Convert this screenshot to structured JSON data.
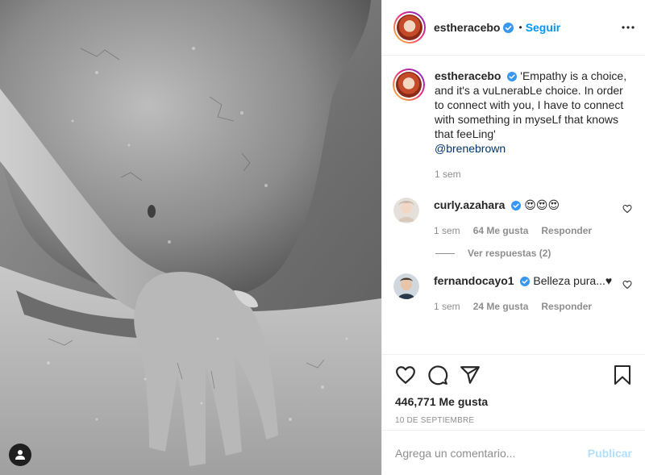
{
  "post": {
    "author": "estheracebo",
    "follow_label": "Seguir",
    "dot": "•",
    "caption_text": "'Empathy is a choice, and it's a vuLnerabLe choice. In order to connect with you, I have to connect with something in myseLf that knows that feeLing'",
    "caption_mention": "@brenebrown",
    "caption_time": "1 sem",
    "likes_label": "446,771 Me gusta",
    "date_label": "10 DE SEPTIEMBRE"
  },
  "comments": [
    {
      "user": "curly.azahara",
      "text": "😍😍😍",
      "time": "1 sem",
      "likes": "64 Me gusta",
      "reply_label": "Responder",
      "view_replies": "Ver respuestas (2)"
    },
    {
      "user": "fernandocayo1",
      "text": "Belleza pura...♥",
      "time": "1 sem",
      "likes": "24 Me gusta",
      "reply_label": "Responder"
    }
  ],
  "composer": {
    "placeholder": "Agrega un comentario...",
    "publish_label": "Publicar"
  },
  "icons": {
    "more": "more-options-icon",
    "verified": "verified-badge-icon",
    "like": "heart-icon",
    "comment": "comment-icon",
    "share": "share-icon",
    "save": "bookmark-icon",
    "user_tags": "user-tags-icon"
  },
  "colors": {
    "link_blue": "#0095f6",
    "publish_disabled": "#b2dffc",
    "muted": "#8e8e8e",
    "text": "#262626"
  }
}
